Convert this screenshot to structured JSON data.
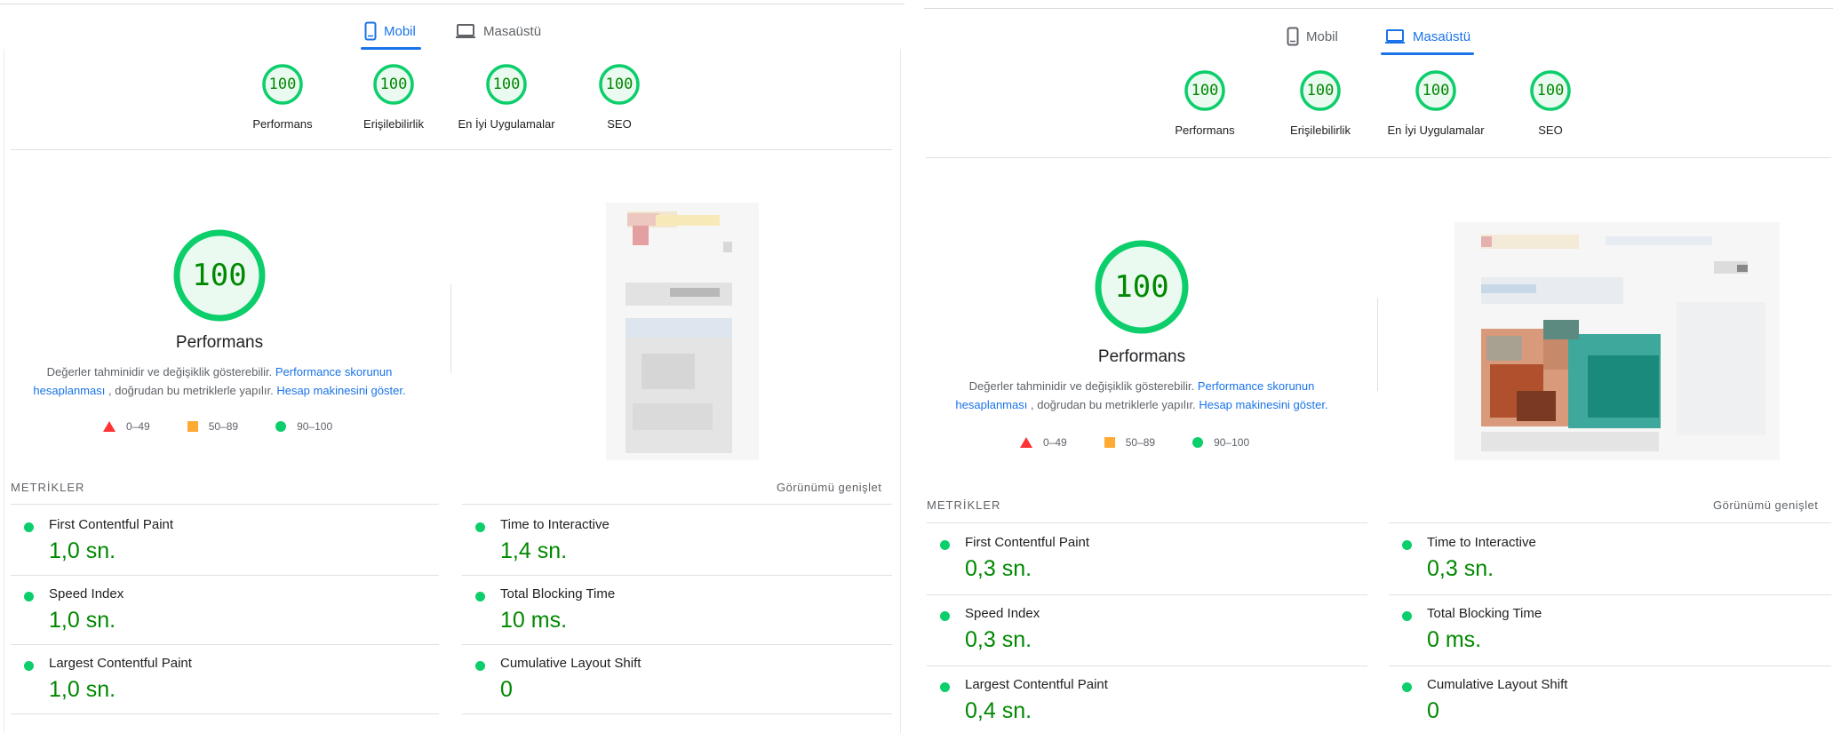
{
  "colors": {
    "pass": "#0cce6b",
    "pass_text": "#008800",
    "average": "#ffaa33",
    "fail": "#ff3333",
    "link": "#1a73e8"
  },
  "left": {
    "tabs": {
      "mobile": "Mobil",
      "desktop": "Masaüstü",
      "active": "mobile"
    },
    "categories": [
      {
        "label": "Performans",
        "score": "100"
      },
      {
        "label": "Erişilebilirlik",
        "score": "100"
      },
      {
        "label": "En İyi Uygulamalar",
        "score": "100"
      },
      {
        "label": "SEO",
        "score": "100"
      }
    ],
    "main_score": "100",
    "main_title": "Performans",
    "desc_prefix": "Değerler tahminidir ve değişiklik gösterebilir.",
    "desc_link1": "Performance skorunun hesaplanması",
    "desc_middle": ", doğrudan bu metriklerle yapılır.",
    "desc_link2": "Hesap makinesini göster.",
    "legend": [
      {
        "icon": "triangle-icon",
        "label": "0–49"
      },
      {
        "icon": "square-icon",
        "label": "50–89"
      },
      {
        "icon": "circle-icon",
        "label": "90–100"
      }
    ],
    "metrics_title": "METRİKLER",
    "expand_label": "Görünümü genişlet",
    "metrics": [
      {
        "name": "First Contentful Paint",
        "value": "1,0 sn."
      },
      {
        "name": "Time to Interactive",
        "value": "1,4 sn."
      },
      {
        "name": "Speed Index",
        "value": "1,0 sn."
      },
      {
        "name": "Total Blocking Time",
        "value": "10 ms."
      },
      {
        "name": "Largest Contentful Paint",
        "value": "1,0 sn."
      },
      {
        "name": "Cumulative Layout Shift",
        "value": "0"
      }
    ]
  },
  "right": {
    "tabs": {
      "mobile": "Mobil",
      "desktop": "Masaüstü",
      "active": "desktop"
    },
    "categories": [
      {
        "label": "Performans",
        "score": "100"
      },
      {
        "label": "Erişilebilirlik",
        "score": "100"
      },
      {
        "label": "En İyi Uygulamalar",
        "score": "100"
      },
      {
        "label": "SEO",
        "score": "100"
      }
    ],
    "main_score": "100",
    "main_title": "Performans",
    "desc_prefix": "Değerler tahminidir ve değişiklik gösterebilir.",
    "desc_link1": "Performance skorunun hesaplanması",
    "desc_middle": ", doğrudan bu metriklerle yapılır.",
    "desc_link2": "Hesap makinesini göster.",
    "legend": [
      {
        "icon": "triangle-icon",
        "label": "0–49"
      },
      {
        "icon": "square-icon",
        "label": "50–89"
      },
      {
        "icon": "circle-icon",
        "label": "90–100"
      }
    ],
    "metrics_title": "METRİKLER",
    "expand_label": "Görünümü genişlet",
    "metrics": [
      {
        "name": "First Contentful Paint",
        "value": "0,3 sn."
      },
      {
        "name": "Time to Interactive",
        "value": "0,3 sn."
      },
      {
        "name": "Speed Index",
        "value": "0,3 sn."
      },
      {
        "name": "Total Blocking Time",
        "value": "0 ms."
      },
      {
        "name": "Largest Contentful Paint",
        "value": "0,4 sn."
      },
      {
        "name": "Cumulative Layout Shift",
        "value": "0"
      }
    ]
  }
}
